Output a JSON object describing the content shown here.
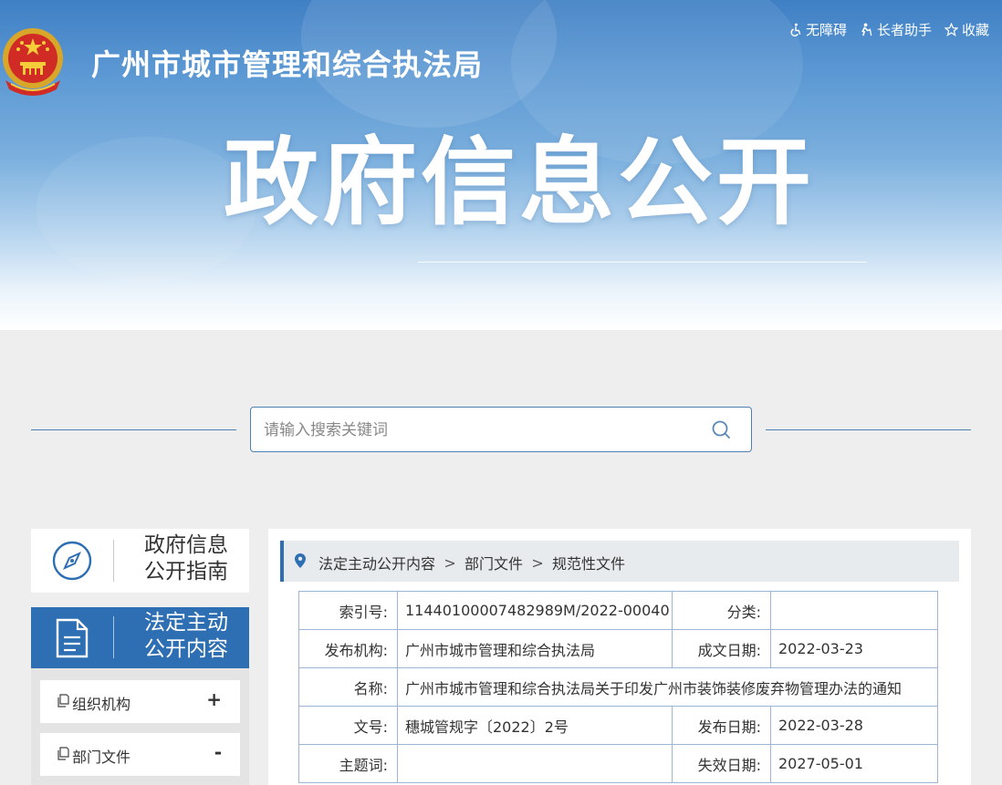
{
  "header": {
    "org_title": "广州市城市管理和综合执法局",
    "banner_title": "政府信息公开",
    "top_links": [
      {
        "label": "无障碍",
        "icon": "accessibility-icon"
      },
      {
        "label": "长者助手",
        "icon": "elder-assist-icon"
      },
      {
        "label": "收藏",
        "icon": "star-icon"
      }
    ]
  },
  "search": {
    "placeholder": "请输入搜索关键词",
    "icon": "search-icon"
  },
  "sidebar": {
    "guide": {
      "line1": "政府信息",
      "line2": "公开指南",
      "icon": "compass-icon"
    },
    "active": {
      "line1": "法定主动",
      "line2": "公开内容",
      "icon": "document-icon"
    },
    "items": [
      {
        "label": "组织机构",
        "toggle": "+"
      },
      {
        "label": "部门文件",
        "toggle": "-"
      }
    ]
  },
  "breadcrumb": {
    "items": [
      "法定主动公开内容",
      "部门文件",
      "规范性文件"
    ],
    "separator": ">"
  },
  "info_table": {
    "index_no_label": "索引号:",
    "index_no": "11440100007482989M/2022-00040",
    "category_label": "分类:",
    "category": "",
    "publisher_label": "发布机构:",
    "publisher": "广州市城市管理和综合执法局",
    "created_label": "成文日期:",
    "created": "2022-03-23",
    "name_label": "名称:",
    "name": "广州市城市管理和综合执法局关于印发广州市装饰装修废弃物管理办法的通知",
    "doc_no_label": "文号:",
    "doc_no": "穗城管规字〔2022〕2号",
    "publish_date_label": "发布日期:",
    "publish_date": "2022-03-28",
    "subject_label": "主题词:",
    "subject": "",
    "expire_label": "失效日期:",
    "expire": "2027-05-01"
  },
  "colors": {
    "accent": "#2e6eb3",
    "table_border": "#9ab5d6",
    "page_bg": "#eeeeee"
  }
}
